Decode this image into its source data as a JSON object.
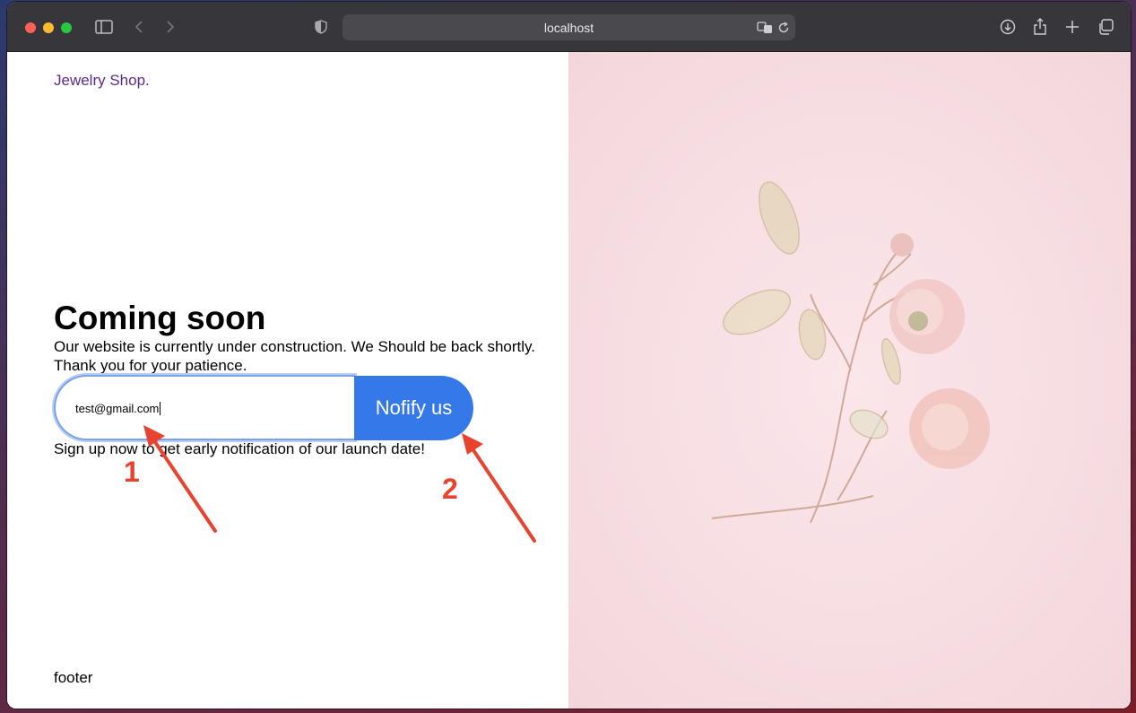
{
  "browser": {
    "url": "localhost",
    "icons": [
      "sidebar-icon",
      "back-icon",
      "forward-icon",
      "shield-icon",
      "translate-icon",
      "reload-icon",
      "download-icon",
      "share-icon",
      "new-tab-icon",
      "tabs-overview-icon"
    ]
  },
  "page": {
    "brand": "Jewelry Shop.",
    "heading": "Coming soon",
    "description": "Our website is currently under construction. We Should be back shortly. Thank you for your patience.",
    "email_value": "test@gmail.com",
    "notify_label": "Nofify us",
    "signup_text": "Sign up now to get early notification of our launch date!",
    "footer": "footer"
  },
  "annotations": {
    "marker_1": "1",
    "marker_2": "2",
    "color": "#e8432e"
  },
  "colors": {
    "brand": "#5b2a8f",
    "button": "#3579e8",
    "hero_background": "#f6dde2"
  }
}
